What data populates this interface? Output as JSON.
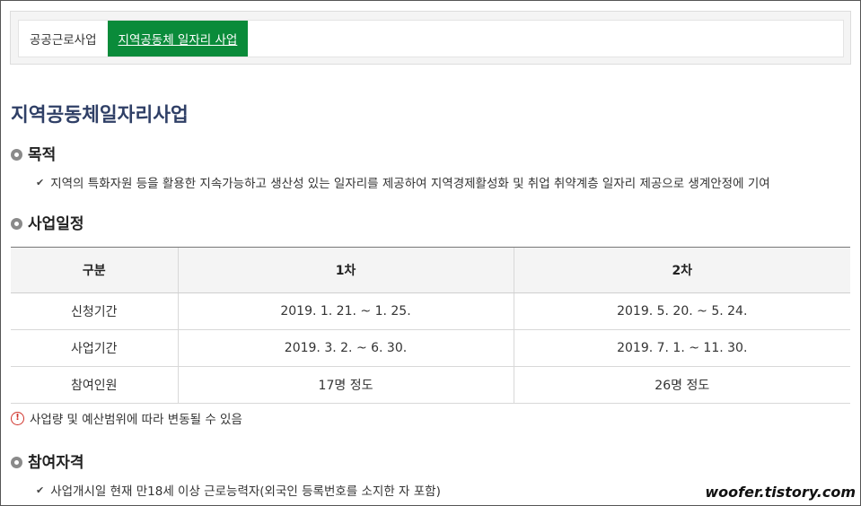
{
  "tabs": [
    {
      "label": "공공근로사업",
      "active": false
    },
    {
      "label": "지역공동체 일자리 사업",
      "active": true
    }
  ],
  "title": "지역공동체일자리사업",
  "purpose": {
    "heading": "목적",
    "text": "지역의 특화자원 등을 활용한 지속가능하고 생산성 있는 일자리를 제공하여 지역경제활성화 및 취업 취약계층 일자리 제공으로 생계안정에 기여"
  },
  "schedule": {
    "heading": "사업일정",
    "headers": [
      "구분",
      "1차",
      "2차"
    ],
    "rows": [
      [
        "신청기간",
        "2019. 1. 21. ~ 1. 25.",
        "2019. 5. 20. ~ 5. 24."
      ],
      [
        "사업기간",
        "2019. 3. 2. ~ 6. 30.",
        "2019. 7. 1. ~ 11. 30."
      ],
      [
        "참여인원",
        "17명 정도",
        "26명 정도"
      ]
    ],
    "note": "사업량 및 예산범위에 따라 변동될 수 있음"
  },
  "eligibility": {
    "heading": "참여자격",
    "text": "사업개시일 현재 만18세 이상 근로능력자(외국인 등록번호를 소지한 자 포함)"
  },
  "watermark": "woofer.tistory.com",
  "colors": {
    "tab_active": "#0a8b3a",
    "title": "#2f3f66",
    "warning": "#d0342c"
  }
}
